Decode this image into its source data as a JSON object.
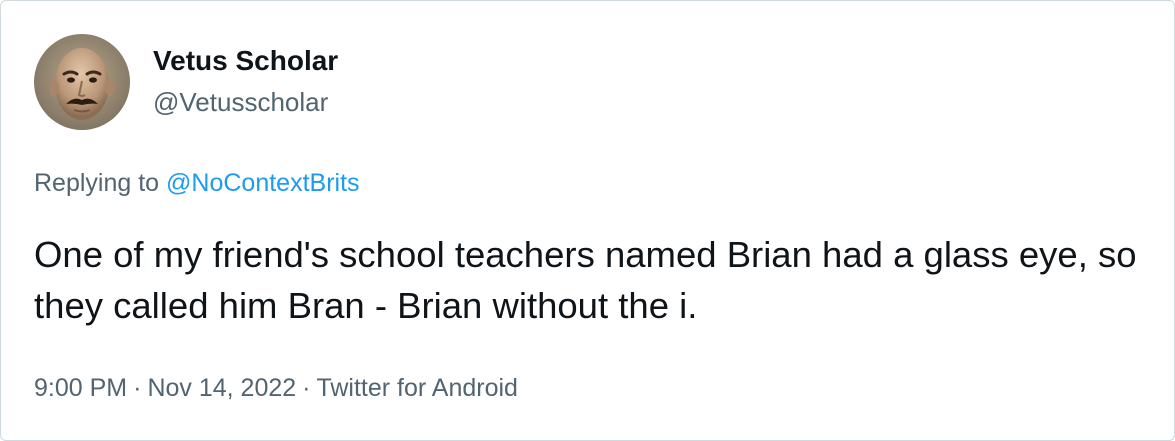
{
  "tweet": {
    "author": {
      "display_name": "Vetus Scholar",
      "handle": "@Vetusscholar"
    },
    "replying_to_label": "Replying to",
    "replying_to_handle": "@NoContextBrits",
    "text": "One of my friend's school teachers named Brian had a glass eye, so they called him Bran - Brian without the i.",
    "time": "9:00 PM",
    "separator": "·",
    "date": "Nov 14, 2022",
    "source": "Twitter for Android"
  },
  "colors": {
    "text_primary": "#0f1419",
    "text_secondary": "#536471",
    "link": "#1d9bf0",
    "border": "#cfd9de"
  }
}
